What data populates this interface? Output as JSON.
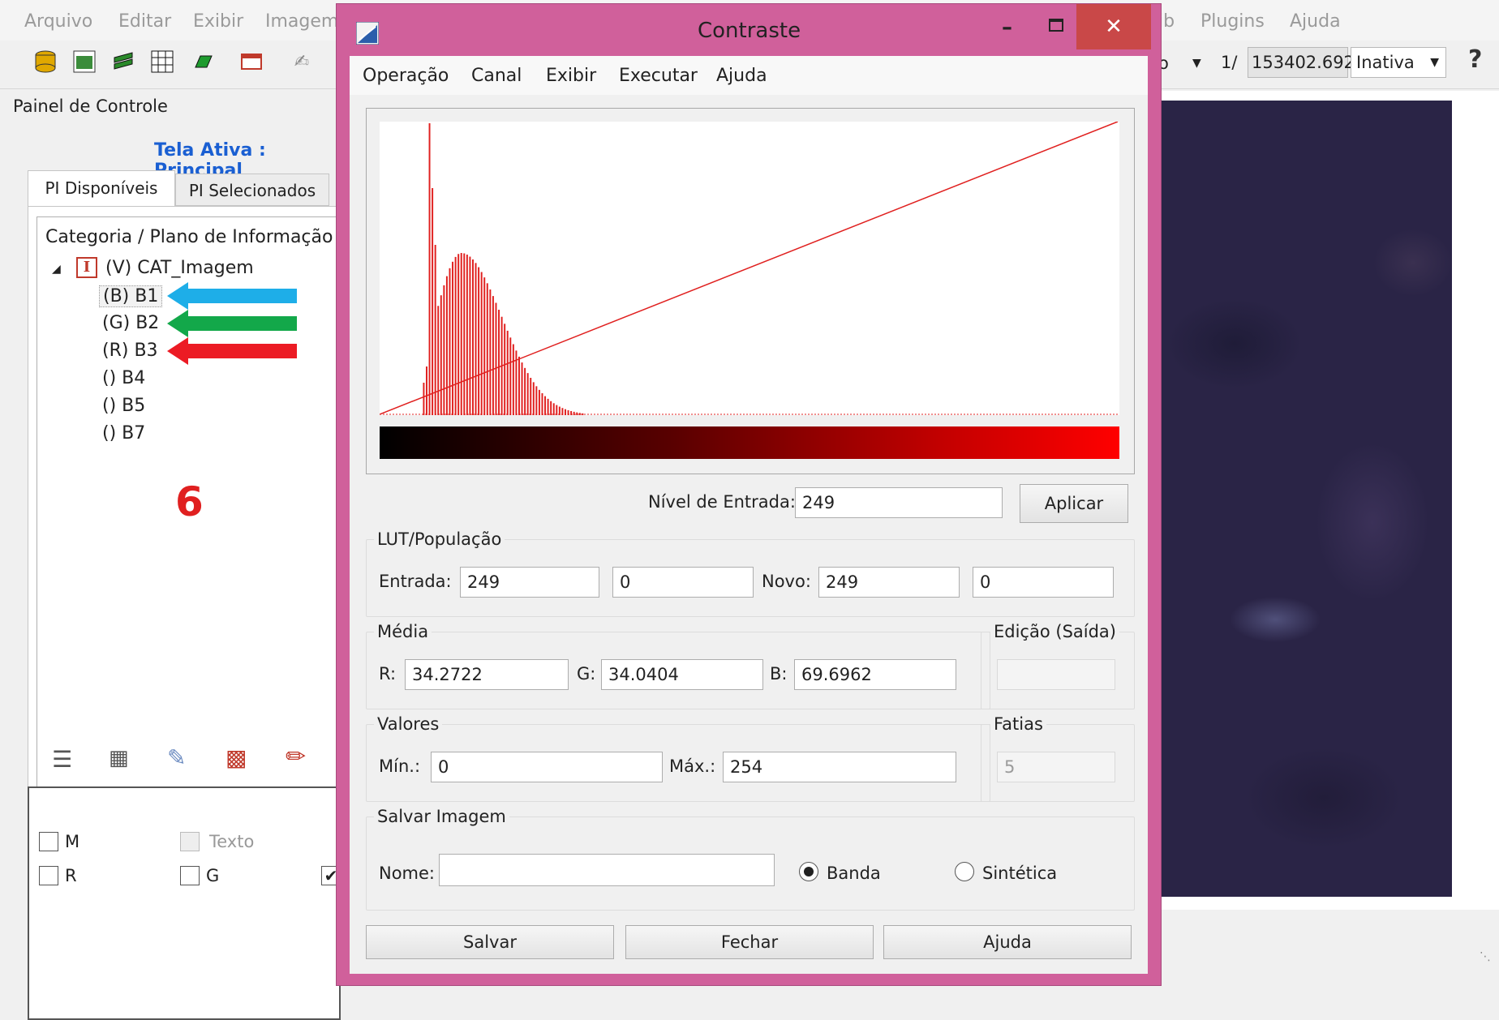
{
  "main_menu": {
    "items": [
      "Arquivo",
      "Editar",
      "Exibir",
      "Imagem"
    ],
    "right_items": [
      "ib",
      "Plugins",
      "Ajuda"
    ]
  },
  "toolbar": {
    "right_partial": "o",
    "scale_prefix": "1/",
    "scale_value": "153402.692",
    "state_value": "Inativa"
  },
  "control_panel": {
    "title": "Painel de Controle",
    "active_screen": "Tela Ativa : Principal",
    "tabs": [
      "PI Disponíveis",
      "PI Selecionados"
    ],
    "tree_header": "Categoria / Plano de Informação",
    "category": "(V) CAT_Imagem",
    "category_badge": "I",
    "bands": [
      "(B) B1",
      "(G) B2",
      "(R) B3",
      "() B4",
      "() B5",
      "() B7"
    ],
    "annotation_number": "6",
    "checkboxes": {
      "m": "M",
      "texto": "Texto",
      "r": "R",
      "g": "G"
    }
  },
  "dialog": {
    "title": "Contraste",
    "menu": [
      "Operação",
      "Canal",
      "Exibir",
      "Executar",
      "Ajuda"
    ],
    "input_level_label": "Nível de Entrada:",
    "input_level_value": "249",
    "apply_label": "Aplicar",
    "lut": {
      "title": "LUT/População",
      "entrada_label": "Entrada:",
      "entrada_value": "249",
      "pop_value": "0",
      "novo_label": "Novo:",
      "novo_value": "249",
      "novo_pop_value": "0"
    },
    "media": {
      "title": "Média",
      "r_label": "R:",
      "r_value": "34.2722",
      "g_label": "G:",
      "g_value": "34.0404",
      "b_label": "B:",
      "b_value": "69.6962"
    },
    "edicao": {
      "title": "Edição (Saída)",
      "value": ""
    },
    "valores": {
      "title": "Valores",
      "min_label": "Mín.:",
      "min_value": "0",
      "max_label": "Máx.:",
      "max_value": "254"
    },
    "fatias": {
      "title": "Fatias",
      "value": "5"
    },
    "salvar_imagem": {
      "title": "Salvar Imagem",
      "nome_label": "Nome:",
      "nome_value": "",
      "banda_label": "Banda",
      "sintetica_label": "Sintética",
      "selected": "Banda"
    },
    "buttons": {
      "salvar": "Salvar",
      "fechar": "Fechar",
      "ajuda": "Ajuda"
    }
  },
  "colors": {
    "dialog_frame": "#d0609b",
    "close_button": "#c94848",
    "curve": "#e0201f",
    "link_blue": "#1a5fd2",
    "annotation_red": "#e02020",
    "arrow_blue": "#1eaee8",
    "arrow_green": "#13a84a",
    "arrow_red": "#ec1b24",
    "satellite": "#2a2446"
  }
}
